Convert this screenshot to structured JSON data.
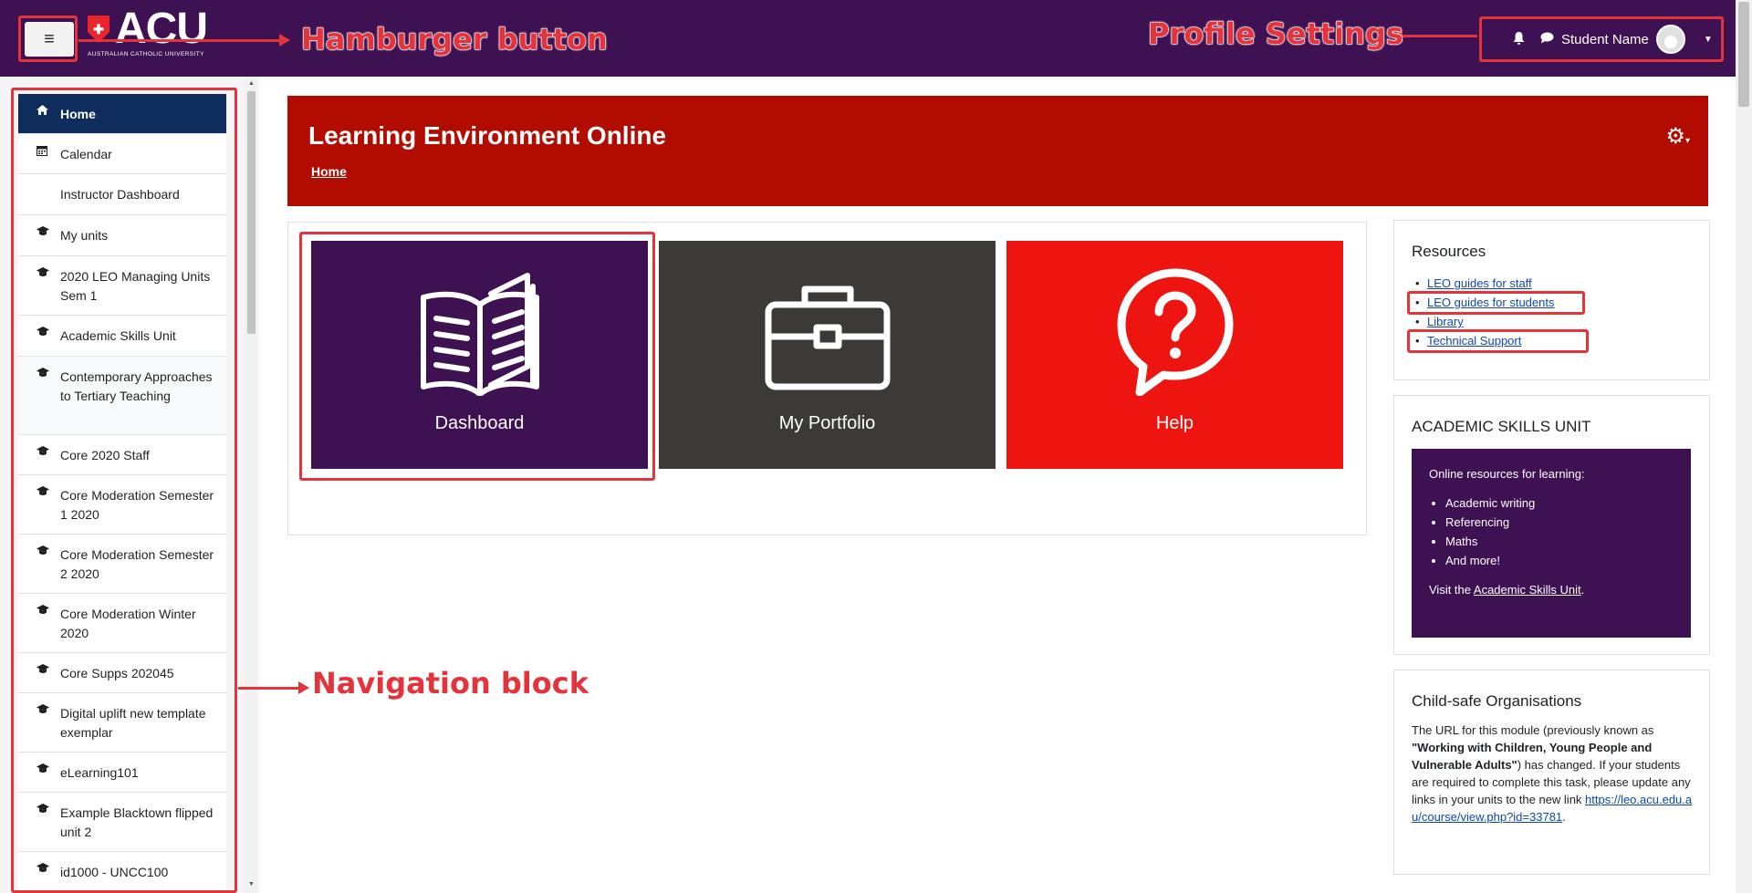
{
  "topbar": {
    "hamburger_glyph": "≡",
    "logo_text": "ACU",
    "logo_subtitle": "AUSTRALIAN CATHOLIC UNIVERSITY",
    "user_name": "Student Name",
    "bell_icon": "bell-icon",
    "chat_icon": "chat-icon"
  },
  "annotations": {
    "hamburger": "Hamburger button",
    "profile": "Profile Settings",
    "navigation": "Navigation block"
  },
  "nav": {
    "items": [
      {
        "label": "Home",
        "icon": "home-icon"
      },
      {
        "label": "Calendar",
        "icon": "calendar-icon"
      },
      {
        "label": "Instructor Dashboard",
        "icon": ""
      },
      {
        "label": "My units",
        "icon": "graduation-cap-icon"
      },
      {
        "label": "2020 LEO Managing Units Sem 1",
        "icon": "graduation-cap-icon"
      },
      {
        "label": "Academic Skills Unit",
        "icon": "graduation-cap-icon"
      },
      {
        "label": "Contemporary Approaches to Tertiary Teaching",
        "icon": "graduation-cap-icon"
      },
      {
        "label": "Core 2020 Staff",
        "icon": "graduation-cap-icon"
      },
      {
        "label": "Core Moderation Semester 1 2020",
        "icon": "graduation-cap-icon"
      },
      {
        "label": "Core Moderation Semester 2 2020",
        "icon": "graduation-cap-icon"
      },
      {
        "label": "Core Moderation Winter 2020",
        "icon": "graduation-cap-icon"
      },
      {
        "label": "Core Supps 202045",
        "icon": "graduation-cap-icon"
      },
      {
        "label": "Digital uplift new template exemplar",
        "icon": "graduation-cap-icon"
      },
      {
        "label": "eLearning101",
        "icon": "graduation-cap-icon"
      },
      {
        "label": "Example Blacktown flipped unit 2",
        "icon": "graduation-cap-icon"
      },
      {
        "label": "id1000 - UNCC100",
        "icon": "graduation-cap-icon"
      }
    ]
  },
  "banner": {
    "title": "Learning Environment Online",
    "breadcrumb": "Home"
  },
  "tiles": [
    {
      "label": "Dashboard",
      "color": "#3d1152",
      "icon": "open-book-icon"
    },
    {
      "label": "My Portfolio",
      "color": "#3c3a36",
      "icon": "briefcase-icon"
    },
    {
      "label": "Help",
      "color": "#ee1410",
      "icon": "question-bubble-icon"
    }
  ],
  "resources": {
    "title": "Resources",
    "links": [
      "LEO guides for staff",
      "LEO guides for students",
      "Library",
      "Technical Support"
    ]
  },
  "asu": {
    "title": "ACADEMIC SKILLS UNIT",
    "intro": "Online resources for learning:",
    "items": [
      "Academic writing",
      "Referencing",
      "Maths",
      "And more!"
    ],
    "visit_prefix": "Visit the ",
    "visit_link": "Academic Skills Unit",
    "visit_suffix": "."
  },
  "childsafe": {
    "title": "Child-safe Organisations",
    "text1": "The URL for this module (previously known as ",
    "bold": "\"Working with Children, Young People and Vulnerable Adults\"",
    "text2": ") has changed. If your students are required to complete this task, please update any links in your units to the new link ",
    "link": "https://leo.acu.edu.au/course/view.php?id=33781",
    "text3": "."
  },
  "colors": {
    "topbar": "#3d1152",
    "banner": "#b20b00",
    "annotation": "#e3343c",
    "nav_active": "#0f2d5c"
  }
}
